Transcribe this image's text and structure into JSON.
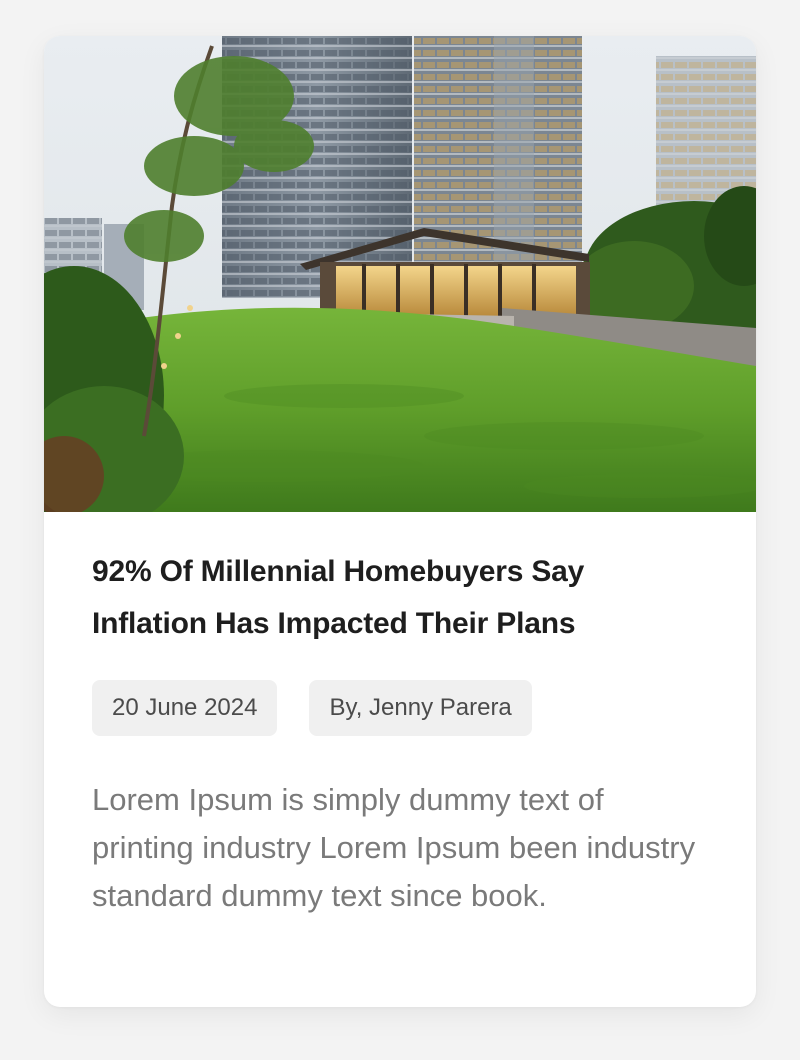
{
  "article": {
    "title_line1": "92% Of Millennial Homebuyers Say",
    "title_line2": "Inflation Has Impacted Their Plans",
    "date": "20 June 2024",
    "author": "By, Jenny Parera",
    "excerpt": "Lorem Ipsum is simply dummy text of printing industry Lorem Ipsum been industry standard dummy text since book."
  },
  "colors": {
    "background": "#f3f3f3",
    "card": "#ffffff",
    "title": "#1e1e1e",
    "pill_bg": "#f0f0f0",
    "pill_text": "#4b4b4b",
    "excerpt": "#7a7a7a",
    "lawn": "#5b9a2c"
  },
  "image": {
    "icon": "building-lawn-photo"
  }
}
